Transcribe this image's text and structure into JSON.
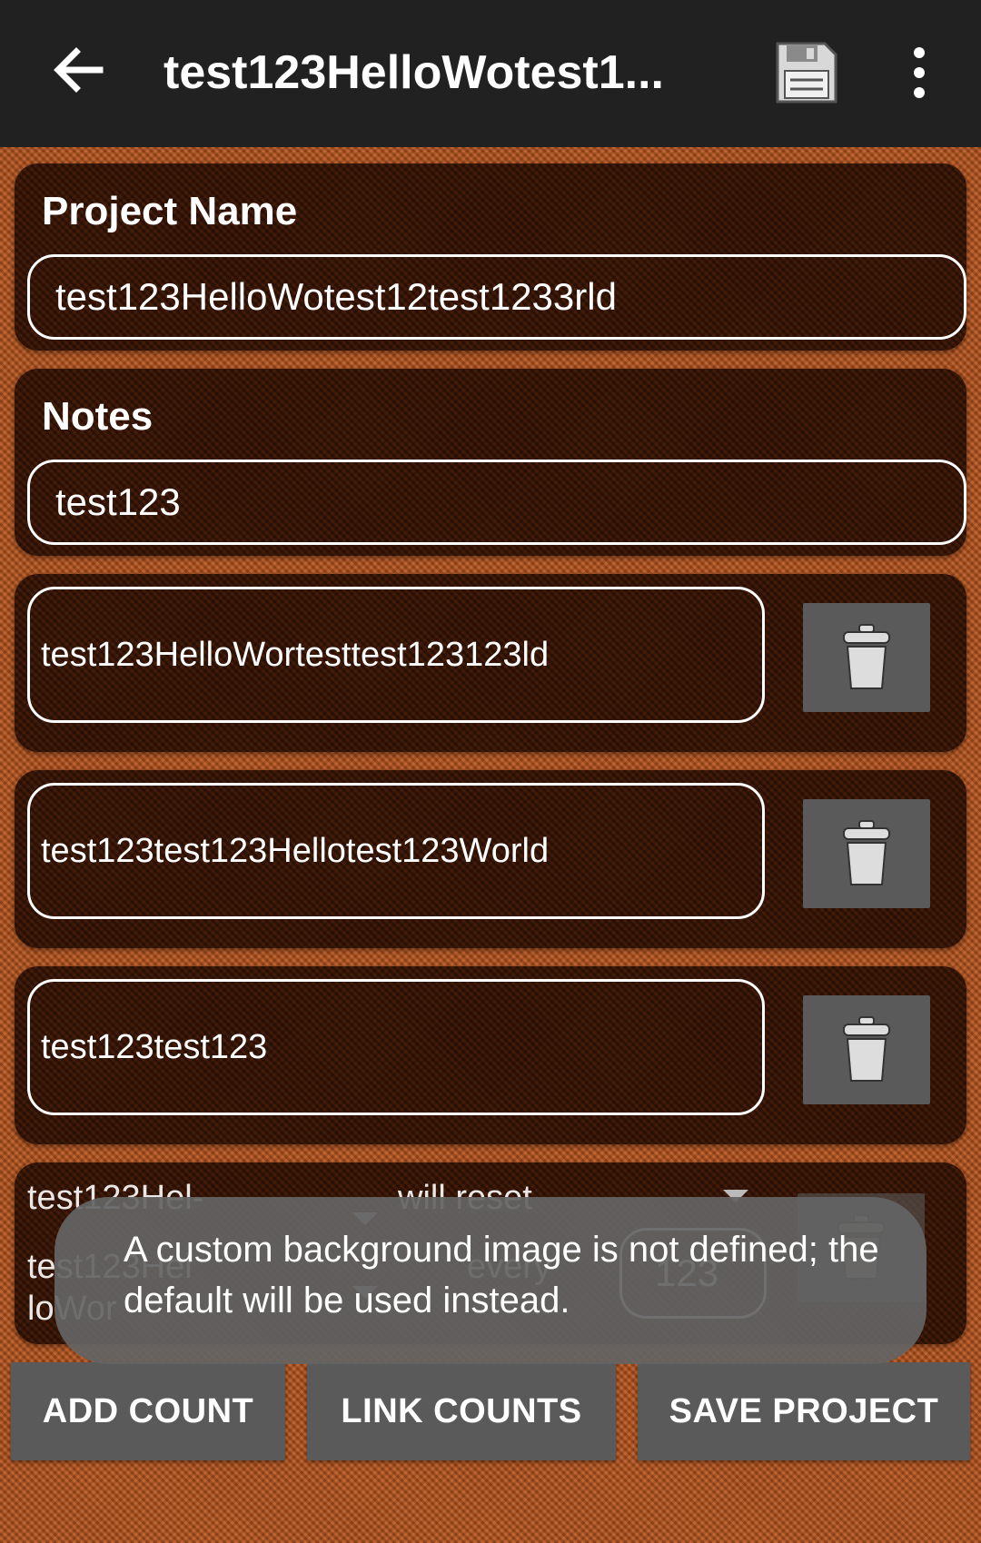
{
  "appbar": {
    "title": "test123HelloWotest1..."
  },
  "project_name": {
    "label": "Project Name",
    "value": "test123HelloWotest12test1233rld"
  },
  "notes": {
    "label": "Notes",
    "value": "test123"
  },
  "counts": [
    {
      "name": "test123HelloWortesttest123123ld"
    },
    {
      "name": "test123test123Hellotest123World"
    },
    {
      "name": "test123test123"
    }
  ],
  "linked_count": {
    "row1_left": "test123Hel-",
    "row1_right": "will reset",
    "row2_left": "test123Hel",
    "row3_left": "loWor",
    "row2_mid": "every",
    "row2_value": "123"
  },
  "buttons": {
    "add_count": "ADD COUNT",
    "link_counts": "LINK COUNTS",
    "save_project": "SAVE PROJECT"
  },
  "toast": {
    "message": "A custom background image is not defined; the default will be used instead."
  },
  "colors": {
    "appbar": "#212121",
    "card": "#3a1607",
    "button": "#5a5a5a",
    "background": "#b9561f"
  },
  "icons": [
    "back-arrow-icon",
    "floppy-disk-icon",
    "more-vert-icon",
    "trash-icon"
  ]
}
